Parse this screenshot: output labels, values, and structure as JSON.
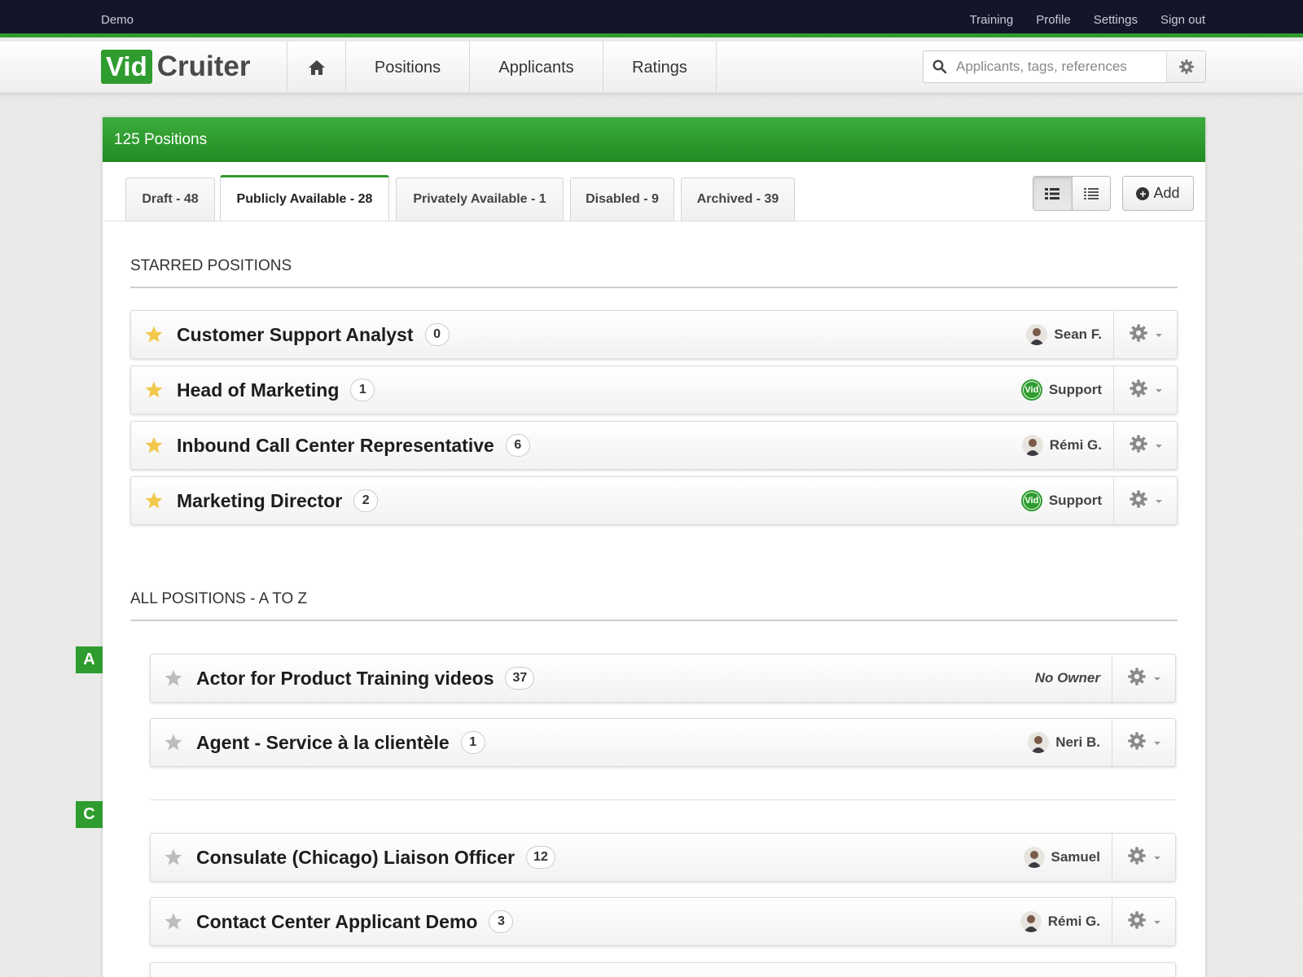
{
  "topbar": {
    "account": "Demo",
    "links": [
      "Training",
      "Profile",
      "Settings",
      "Sign out"
    ]
  },
  "nav": {
    "logo_part1": "Vid",
    "logo_part2": "Cruiter",
    "items": [
      "Positions",
      "Applicants",
      "Ratings"
    ],
    "search_placeholder": "Applicants, tags, references"
  },
  "panel": {
    "title": "125 Positions",
    "tabs": [
      {
        "label": "Draft - 48",
        "active": false
      },
      {
        "label": "Publicly Available - 28",
        "active": true
      },
      {
        "label": "Privately Available - 1",
        "active": false
      },
      {
        "label": "Disabled - 9",
        "active": false
      },
      {
        "label": "Archived - 39",
        "active": false
      }
    ],
    "add_label": "Add"
  },
  "starred": {
    "title": "STARRED POSITIONS",
    "rows": [
      {
        "title": "Customer Support Analyst",
        "count": "0",
        "owner": "Sean F.",
        "avatar": "person"
      },
      {
        "title": "Head of Marketing",
        "count": "1",
        "owner": "Support",
        "avatar": "vid"
      },
      {
        "title": "Inbound Call Center Representative",
        "count": "6",
        "owner": "Rémi G.",
        "avatar": "person"
      },
      {
        "title": "Marketing Director",
        "count": "2",
        "owner": "Support",
        "avatar": "vid"
      }
    ]
  },
  "all": {
    "title": "ALL POSITIONS - A TO Z",
    "letters": [
      "A",
      "C"
    ],
    "rows": [
      {
        "title": "Actor for Product Training videos",
        "count": "37",
        "owner": "No Owner",
        "avatar": "none"
      },
      {
        "title": "Agent - Service à la clientèle",
        "count": "1",
        "owner": "Neri B.",
        "avatar": "person"
      },
      {
        "title": "Consulate (Chicago) Liaison Officer",
        "count": "12",
        "owner": "Samuel",
        "avatar": "person"
      },
      {
        "title": "Contact Center Applicant Demo",
        "count": "3",
        "owner": "Rémi G.",
        "avatar": "person"
      }
    ]
  },
  "avatar_vid_text": "Vid",
  "colors": {
    "brand_green": "#2e9c2e",
    "topbar": "#14152b",
    "star_gold": "#f2c84b",
    "star_gray": "#bdbdbd"
  }
}
